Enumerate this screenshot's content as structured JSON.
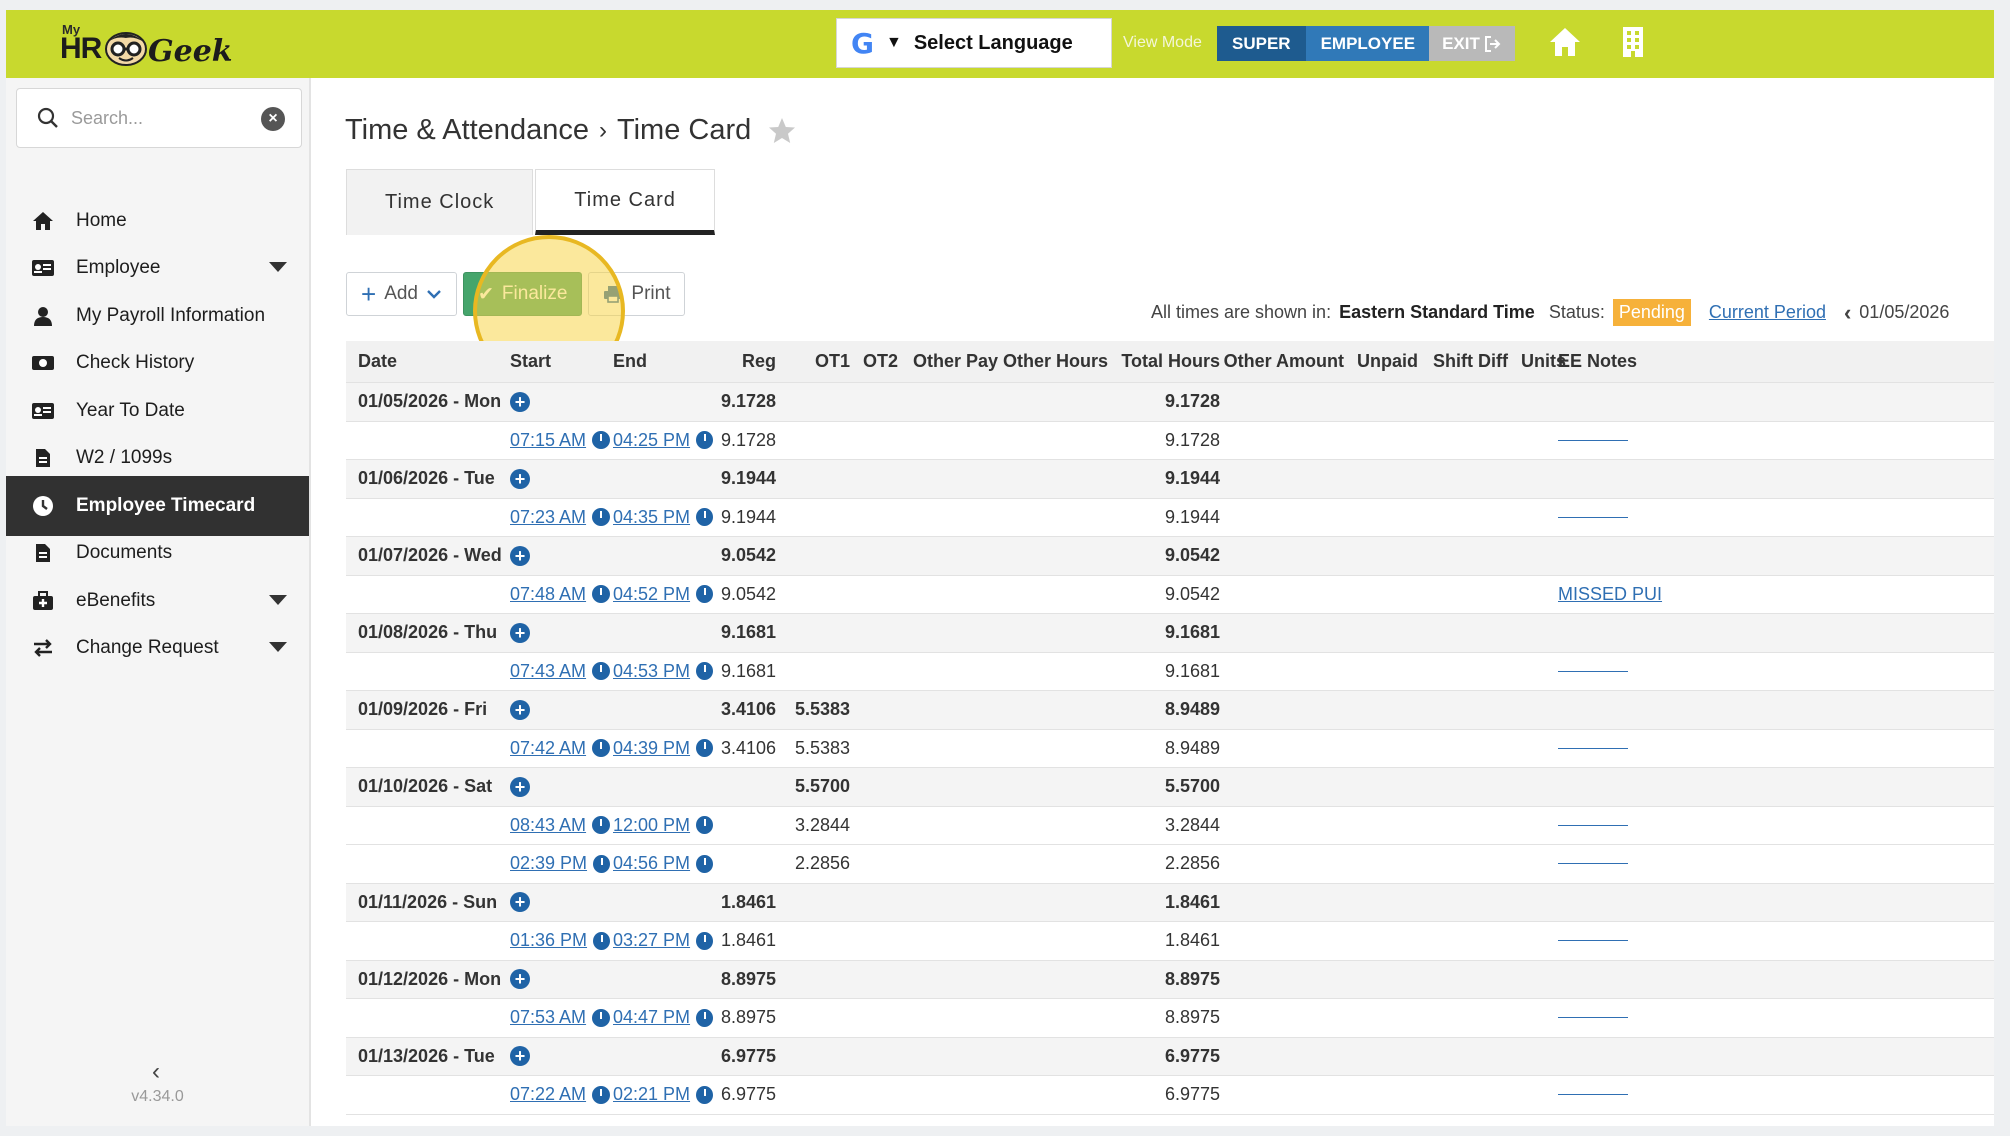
{
  "topbar": {
    "logo_my": "My",
    "logo_hr": "HR",
    "logo_geek": "Geek",
    "language_label": "Select Language",
    "view_mode_label": "View Mode",
    "super_label": "SUPER",
    "employee_label": "EMPLOYEE",
    "exit_label": "EXIT",
    "colors": {
      "bar": "#c8d92e",
      "super": "#1e5b8f",
      "employee": "#3079b8"
    }
  },
  "sidebar": {
    "search_placeholder": "Search...",
    "items": [
      {
        "label": "Home",
        "icon": "home-icon"
      },
      {
        "label": "Employee",
        "icon": "id-card-icon",
        "caret": true
      },
      {
        "label": "My Payroll Information",
        "icon": "user-icon"
      },
      {
        "label": "Check History",
        "icon": "money-icon"
      },
      {
        "label": "Year To Date",
        "icon": "id-card-icon"
      },
      {
        "label": "W2 / 1099s",
        "icon": "file-icon"
      },
      {
        "label": "Employee Timecard",
        "icon": "clock-icon",
        "active": true
      },
      {
        "label": "Documents",
        "icon": "file-icon"
      },
      {
        "label": "eBenefits",
        "icon": "medkit-icon",
        "caret": true
      },
      {
        "label": "Change Request",
        "icon": "exchange-icon",
        "caret": true
      }
    ],
    "version": "v4.34.0"
  },
  "page": {
    "breadcrumb_parent": "Time & Attendance",
    "breadcrumb_sep": "›",
    "breadcrumb_current": "Time Card",
    "tabs": [
      "Time Clock",
      "Time Card"
    ],
    "add_label": "Add",
    "finalize_label": "Finalize",
    "print_label": "Print",
    "timezone_prefix": "All times are shown in:",
    "timezone": "Eastern Standard Time",
    "status_label": "Status:",
    "status_value": "Pending",
    "current_period": "Current Period",
    "period_start": "01/05/2026"
  },
  "table": {
    "columns": [
      "Date",
      "Start",
      "End",
      "Reg",
      "OT1",
      "OT2",
      "Other Pay",
      "Other Hours",
      "Total Hours",
      "Other Amount",
      "Unpaid",
      "Shift Diff",
      "Units",
      "EE Notes"
    ],
    "rows": [
      {
        "type": "day",
        "date": "01/05/2026 - Mon",
        "reg": "9.1728",
        "ot1": "",
        "total": "9.1728"
      },
      {
        "type": "punch",
        "start": "07:15 AM",
        "end": "04:25 PM",
        "reg": "9.1728",
        "ot1": "",
        "total": "9.1728",
        "notes": ""
      },
      {
        "type": "day",
        "date": "01/06/2026 - Tue",
        "reg": "9.1944",
        "ot1": "",
        "total": "9.1944"
      },
      {
        "type": "punch",
        "start": "07:23 AM",
        "end": "04:35 PM",
        "reg": "9.1944",
        "ot1": "",
        "total": "9.1944",
        "notes": ""
      },
      {
        "type": "day",
        "date": "01/07/2026 - Wed",
        "reg": "9.0542",
        "ot1": "",
        "total": "9.0542"
      },
      {
        "type": "punch",
        "start": "07:48 AM",
        "end": "04:52 PM",
        "reg": "9.0542",
        "ot1": "",
        "total": "9.0542",
        "notes": "MISSED PUI"
      },
      {
        "type": "day",
        "date": "01/08/2026 - Thu",
        "reg": "9.1681",
        "ot1": "",
        "total": "9.1681"
      },
      {
        "type": "punch",
        "start": "07:43 AM",
        "end": "04:53 PM",
        "reg": "9.1681",
        "ot1": "",
        "total": "9.1681",
        "notes": ""
      },
      {
        "type": "day",
        "date": "01/09/2026 - Fri",
        "reg": "3.4106",
        "ot1": "5.5383",
        "total": "8.9489"
      },
      {
        "type": "punch",
        "start": "07:42 AM",
        "end": "04:39 PM",
        "reg": "3.4106",
        "ot1": "5.5383",
        "total": "8.9489",
        "notes": ""
      },
      {
        "type": "day",
        "date": "01/10/2026 - Sat",
        "reg": "",
        "ot1": "5.5700",
        "total": "5.5700"
      },
      {
        "type": "punch",
        "start": "08:43 AM",
        "end": "12:00 PM",
        "reg": "",
        "ot1": "3.2844",
        "total": "3.2844",
        "notes": ""
      },
      {
        "type": "punch",
        "start": "02:39 PM",
        "end": "04:56 PM",
        "reg": "",
        "ot1": "2.2856",
        "total": "2.2856",
        "notes": ""
      },
      {
        "type": "day",
        "date": "01/11/2026 - Sun",
        "reg": "1.8461",
        "ot1": "",
        "total": "1.8461"
      },
      {
        "type": "punch",
        "start": "01:36 PM",
        "end": "03:27 PM",
        "reg": "1.8461",
        "ot1": "",
        "total": "1.8461",
        "notes": ""
      },
      {
        "type": "day",
        "date": "01/12/2026 - Mon",
        "reg": "8.8975",
        "ot1": "",
        "total": "8.8975"
      },
      {
        "type": "punch",
        "start": "07:53 AM",
        "end": "04:47 PM",
        "reg": "8.8975",
        "ot1": "",
        "total": "8.8975",
        "notes": ""
      },
      {
        "type": "day",
        "date": "01/13/2026 - Tue",
        "reg": "6.9775",
        "ot1": "",
        "total": "6.9775"
      },
      {
        "type": "punch",
        "start": "07:22 AM",
        "end": "02:21 PM",
        "reg": "6.9775",
        "ot1": "",
        "total": "6.9775",
        "notes": ""
      }
    ]
  }
}
